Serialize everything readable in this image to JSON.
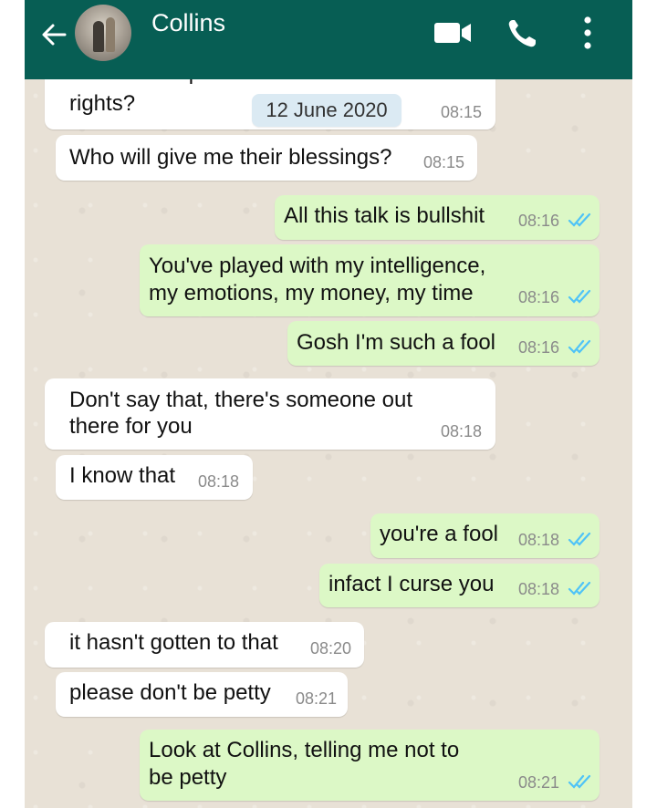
{
  "header": {
    "contact_name": "Collins",
    "back_icon": "arrow-back-icon",
    "icons": [
      "video-call-icon",
      "voice-call-icon",
      "more-options-icon"
    ],
    "bar_color": "#075e54"
  },
  "date_chip": "12 June 2020",
  "colors": {
    "incoming": "#ffffff",
    "outgoing": "#dcf8c6",
    "read_ticks": "#4fc3f7"
  },
  "messages": [
    {
      "dir": "in",
      "lines": [
        "Where will I perform the traditional",
        "rights?"
      ],
      "time": "08:15"
    },
    {
      "dir": "in",
      "lines": [
        "Who will give me their blessings?"
      ],
      "time": "08:15"
    },
    {
      "dir": "out",
      "lines": [
        "All this talk is bullshit"
      ],
      "time": "08:16",
      "read": true
    },
    {
      "dir": "out",
      "lines": [
        "You've played with my intelligence,",
        "my emotions, my money, my time"
      ],
      "time": "08:16",
      "read": true
    },
    {
      "dir": "out",
      "lines": [
        "Gosh I'm such a fool"
      ],
      "time": "08:16",
      "read": true
    },
    {
      "dir": "in",
      "lines": [
        "Don't say that, there's someone out",
        "there for you"
      ],
      "time": "08:18"
    },
    {
      "dir": "in",
      "lines": [
        "I know that"
      ],
      "time": "08:18"
    },
    {
      "dir": "out",
      "lines": [
        "you're a fool"
      ],
      "time": "08:18",
      "read": true
    },
    {
      "dir": "out",
      "lines": [
        "infact I curse you"
      ],
      "time": "08:18",
      "read": true
    },
    {
      "dir": "in",
      "lines": [
        "it hasn't gotten to that"
      ],
      "time": "08:20"
    },
    {
      "dir": "in",
      "lines": [
        "please don't be petty"
      ],
      "time": "08:21"
    },
    {
      "dir": "out",
      "lines": [
        "Look at Collins, telling me not to",
        "be petty"
      ],
      "time": "08:21",
      "read": true
    }
  ]
}
